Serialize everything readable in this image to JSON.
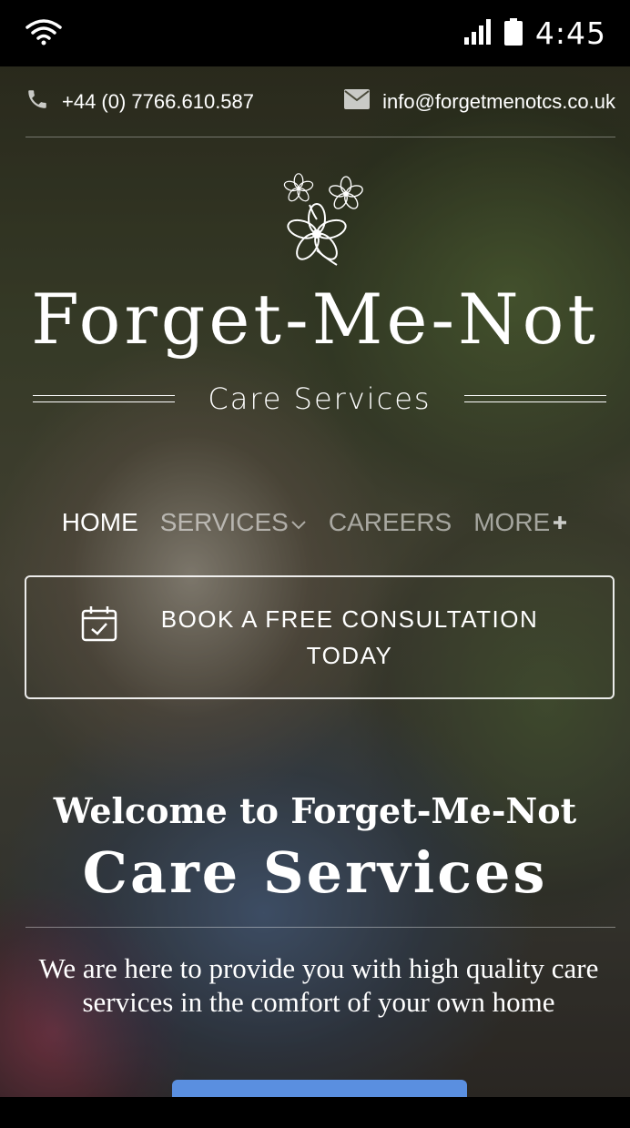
{
  "status_bar": {
    "time": "4:45",
    "icons": [
      "wifi-icon",
      "signal-icon",
      "battery-icon"
    ]
  },
  "contact": {
    "phone": "+44 (0) 7766.610.587",
    "email": "info@forgetmenotcs.co.uk",
    "phone_icon": "phone-icon",
    "email_icon": "envelope-icon"
  },
  "brand": {
    "logo_icon": "forget-me-not-flower-icon",
    "title": "Forget-Me-Not",
    "subtitle": "Care Services"
  },
  "nav": {
    "items": [
      {
        "label": "HOME",
        "active": true
      },
      {
        "label": "SERVICES",
        "icon": "chevron-down-icon"
      },
      {
        "label": "CAREERS"
      },
      {
        "label": "MORE",
        "icon": "plus-icon"
      }
    ]
  },
  "cta": {
    "icon": "calendar-check-icon",
    "label": "BOOK A FREE CONSULTATION TODAY"
  },
  "welcome": {
    "line1": "Welcome to Forget-Me-Not",
    "line2": "Care Services",
    "intro": "We are here to provide you with high quality care services in the comfort of your own home"
  },
  "colors": {
    "button_accent": "#5a8fe0",
    "status_bar": "#000000",
    "text": "#ffffff"
  }
}
